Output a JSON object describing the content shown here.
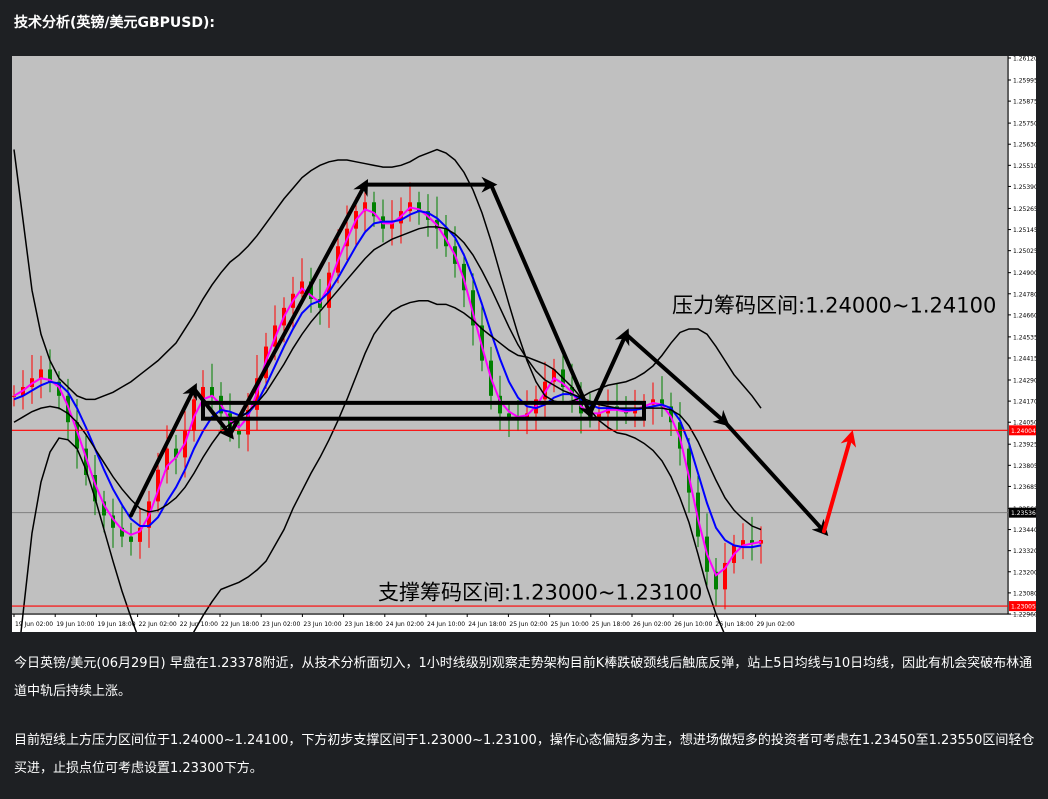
{
  "heading": "技术分析(英镑/美元GBPUSD):",
  "paragraphs": [
    "今日英镑/美元(06月29日) 早盘在1.23378附近，从技术分析面切入，1小时线级别观察走势架构目前K棒跌破颈线后触底反弹，站上5日均线与10日均线，因此有机会突破布林通道中轨后持续上涨。",
    "目前短线上方压力区间位于1.24000~1.24100，下方初步支撑区间于1.23000~1.23100，操作心态偏短多为主，想进场做短多的投资者可考虑在1.23450至1.23550区间轻仓买进，止损点位可考虑设置1.23300下方。"
  ],
  "chart_data": {
    "type": "line",
    "symbol": "GBPUSD",
    "ylim": [
      1.2296,
      1.2612
    ],
    "yticks": [
      "1.26120",
      "1.25995",
      "1.25875",
      "1.25750",
      "1.25630",
      "1.25510",
      "1.25390",
      "1.25265",
      "1.25145",
      "1.25025",
      "1.24900",
      "1.24780",
      "1.24660",
      "1.24535",
      "1.24415",
      "1.24290",
      "1.24170",
      "1.24050",
      "1.23925",
      "1.23805",
      "1.23685",
      "1.23560",
      "1.23440",
      "1.23320",
      "1.23200",
      "1.23080",
      "1.22960"
    ],
    "xticks": [
      "19 Jun 02:00",
      "19 Jun 10:00",
      "19 Jun 18:00",
      "22 Jun 02:00",
      "22 Jun 10:00",
      "22 Jun 18:00",
      "23 Jun 02:00",
      "23 Jun 10:00",
      "23 Jun 18:00",
      "24 Jun 02:00",
      "24 Jun 10:00",
      "24 Jun 18:00",
      "25 Jun 02:00",
      "25 Jun 10:00",
      "25 Jun 18:00",
      "26 Jun 02:00",
      "26 Jun 10:00",
      "26 Jun 18:00",
      "29 Jun 02:00"
    ],
    "current_price_label": "1.23536",
    "current_price": 1.23536,
    "resistance_label": "压力筹码区间:1.24000~1.24100",
    "resistance_level": 1.24004,
    "resistance_price_label": "1.24004",
    "support_label": "支撑筹码区间:1.23000~1.23100",
    "support_level": 1.23005,
    "support_price_label": "1.23005",
    "consolidation_box": [
      1.2407,
      1.2416
    ],
    "close": [
      1.242,
      1.2425,
      1.243,
      1.2435,
      1.2428,
      1.242,
      1.2405,
      1.239,
      1.2375,
      1.236,
      1.2352,
      1.2345,
      1.234,
      1.2337,
      1.2345,
      1.236,
      1.2378,
      1.239,
      1.2385,
      1.24,
      1.2418,
      1.2425,
      1.242,
      1.241,
      1.24,
      1.2398,
      1.2412,
      1.243,
      1.2448,
      1.246,
      1.247,
      1.2478,
      1.2485,
      1.2475,
      1.247,
      1.249,
      1.2505,
      1.2515,
      1.2525,
      1.253,
      1.2522,
      1.2515,
      1.2518,
      1.2525,
      1.253,
      1.2525,
      1.252,
      1.2515,
      1.2505,
      1.2495,
      1.248,
      1.246,
      1.244,
      1.242,
      1.241,
      1.2408,
      1.2406,
      1.241,
      1.2418,
      1.2428,
      1.2435,
      1.2425,
      1.242,
      1.241,
      1.2408,
      1.241,
      1.2414,
      1.2412,
      1.241,
      1.2412,
      1.2415,
      1.2418,
      1.2414,
      1.2405,
      1.239,
      1.2365,
      1.234,
      1.232,
      1.231,
      1.2325,
      1.2335,
      1.2338,
      1.2336,
      1.2338
    ],
    "series": [
      {
        "color": "#ff00ff",
        "values": [
          1.242,
          1.2423,
          1.2427,
          1.243,
          1.2429,
          1.2425,
          1.2414,
          1.24,
          1.2385,
          1.237,
          1.2358,
          1.235,
          1.2344,
          1.2341,
          1.2343,
          1.2352,
          1.2366,
          1.238,
          1.2385,
          1.2393,
          1.2408,
          1.2418,
          1.242,
          1.2415,
          1.2406,
          1.2402,
          1.2408,
          1.2422,
          1.244,
          1.2453,
          1.2465,
          1.2474,
          1.2481,
          1.2477,
          1.2473,
          1.2483,
          1.2497,
          1.2509,
          1.252,
          1.2526,
          1.2524,
          1.2518,
          1.2518,
          1.2522,
          1.2527,
          1.2526,
          1.2522,
          1.2517,
          1.2509,
          1.25,
          1.2486,
          1.2467,
          1.2448,
          1.243,
          1.2417,
          1.2411,
          1.2408,
          1.2409,
          1.2414,
          1.2422,
          1.243,
          1.2427,
          1.2422,
          1.2414,
          1.241,
          1.241,
          1.2412,
          1.2412,
          1.2411,
          1.2412,
          1.2414,
          1.2416,
          1.2415,
          1.2408,
          1.2396,
          1.2374,
          1.235,
          1.233,
          1.2318,
          1.2322,
          1.233,
          1.2335,
          1.2336,
          1.2337
        ]
      },
      {
        "color": "#0000ff",
        "values": [
          1.2418,
          1.242,
          1.2423,
          1.2426,
          1.2428,
          1.2427,
          1.2422,
          1.2413,
          1.2402,
          1.239,
          1.2378,
          1.2367,
          1.2358,
          1.235,
          1.2346,
          1.2346,
          1.2351,
          1.236,
          1.2368,
          1.2378,
          1.239,
          1.24,
          1.2408,
          1.2412,
          1.2411,
          1.2409,
          1.241,
          1.2416,
          1.2426,
          1.2437,
          1.2448,
          1.2458,
          1.2467,
          1.2472,
          1.2474,
          1.2479,
          1.2487,
          1.2496,
          1.2505,
          1.2513,
          1.2518,
          1.2519,
          1.2519,
          1.252,
          1.2523,
          1.2525,
          1.2524,
          1.2521,
          1.2516,
          1.251,
          1.25,
          1.2487,
          1.2472,
          1.2456,
          1.2441,
          1.2428,
          1.2419,
          1.2414,
          1.2413,
          1.2415,
          1.2419,
          1.2421,
          1.2421,
          1.2418,
          1.2415,
          1.2413,
          1.2413,
          1.2413,
          1.2412,
          1.2412,
          1.2413,
          1.2414,
          1.2415,
          1.2413,
          1.2406,
          1.2393,
          1.2376,
          1.2359,
          1.2345,
          1.2338,
          1.2335,
          1.2334,
          1.2334,
          1.2335
        ]
      },
      {
        "color": "#000000",
        "values": [
          1.2405,
          1.2408,
          1.2411,
          1.2413,
          1.2414,
          1.2413,
          1.241,
          1.2405,
          1.2398,
          1.239,
          1.2382,
          1.2374,
          1.2367,
          1.2361,
          1.2356,
          1.2354,
          1.2355,
          1.2358,
          1.2362,
          1.2368,
          1.2376,
          1.2385,
          1.2393,
          1.24,
          1.2404,
          1.2407,
          1.2411,
          1.2416,
          1.2422,
          1.243,
          1.2438,
          1.2447,
          1.2455,
          1.2462,
          1.2468,
          1.2474,
          1.248,
          1.2486,
          1.2492,
          1.2498,
          1.2503,
          1.2506,
          1.2509,
          1.2511,
          1.2513,
          1.2515,
          1.2516,
          1.2516,
          1.2515,
          1.2512,
          1.2507,
          1.25,
          1.2491,
          1.2481,
          1.247,
          1.2459,
          1.2449,
          1.2441,
          1.2434,
          1.2429,
          1.2426,
          1.2423,
          1.2421,
          1.2419,
          1.2417,
          1.2415,
          1.2414,
          1.2413,
          1.2413,
          1.2413,
          1.2413,
          1.2413,
          1.2413,
          1.2412,
          1.2409,
          1.2403,
          1.2394,
          1.2383,
          1.2372,
          1.2362,
          1.2355,
          1.235,
          1.2346,
          1.2344
        ]
      },
      {
        "color": "#000000",
        "values": [
          1.256,
          1.252,
          1.248,
          1.2455,
          1.244,
          1.243,
          1.2425,
          1.242,
          1.2418,
          1.2418,
          1.242,
          1.2422,
          1.2425,
          1.2428,
          1.2432,
          1.2436,
          1.244,
          1.2445,
          1.245,
          1.2458,
          1.2466,
          1.2475,
          1.2483,
          1.249,
          1.2496,
          1.25,
          1.2505,
          1.2511,
          1.2518,
          1.2525,
          1.2532,
          1.2538,
          1.2544,
          1.2548,
          1.2551,
          1.2553,
          1.2554,
          1.2554,
          1.2553,
          1.2552,
          1.2551,
          1.255,
          1.255,
          1.2551,
          1.2553,
          1.2556,
          1.2558,
          1.256,
          1.2558,
          1.2554,
          1.2547,
          1.2537,
          1.2524,
          1.2508,
          1.249,
          1.2472,
          1.2455,
          1.244,
          1.2428,
          1.242,
          1.2417,
          1.2416,
          1.2417,
          1.2419,
          1.2422,
          1.2424,
          1.2426,
          1.2427,
          1.2428,
          1.243,
          1.2433,
          1.2437,
          1.2443,
          1.245,
          1.2456,
          1.2458,
          1.2458,
          1.2455,
          1.2448,
          1.244,
          1.2432,
          1.2426,
          1.242,
          1.2413
        ]
      },
      {
        "color": "#000000",
        "values": [
          1.225,
          1.2296,
          1.2342,
          1.2371,
          1.2388,
          1.2396,
          1.2395,
          1.239,
          1.2378,
          1.2362,
          1.2344,
          1.2326,
          1.2309,
          1.2294,
          1.228,
          1.2272,
          1.227,
          1.2271,
          1.2274,
          1.2278,
          1.2286,
          1.2295,
          1.2303,
          1.231,
          1.2312,
          1.2314,
          1.2317,
          1.2321,
          1.2326,
          1.2335,
          1.2344,
          1.2356,
          1.2366,
          1.2376,
          1.2385,
          1.2395,
          1.2406,
          1.2418,
          1.2431,
          1.2444,
          1.2455,
          1.2462,
          1.2468,
          1.2471,
          1.2473,
          1.2474,
          1.2474,
          1.2472,
          1.2472,
          1.247,
          1.2467,
          1.2463,
          1.2458,
          1.2454,
          1.245,
          1.2446,
          1.2443,
          1.2442,
          1.244,
          1.2438,
          1.2435,
          1.243,
          1.2425,
          1.2419,
          1.2412,
          1.2406,
          1.2402,
          1.2399,
          1.2398,
          1.2396,
          1.2393,
          1.2389,
          1.2383,
          1.2374,
          1.2362,
          1.2348,
          1.233,
          1.2311,
          1.2296,
          1.2284,
          1.2278,
          1.2274,
          1.2272,
          1.2275
        ]
      }
    ],
    "annotations": [
      {
        "type": "arrow",
        "color": "#000000",
        "points": [
          [
            13,
            1.2352
          ],
          [
            20,
            1.2424
          ],
          [
            24,
            1.2398
          ]
        ]
      },
      {
        "type": "arrow",
        "color": "#000000",
        "points": [
          [
            24,
            1.2398
          ],
          [
            39,
            1.254
          ],
          [
            53,
            1.254
          ],
          [
            64,
            1.241
          ]
        ]
      },
      {
        "type": "arrow",
        "color": "#000000",
        "points": [
          [
            64,
            1.241
          ],
          [
            68,
            1.2455
          ],
          [
            79,
            1.2405
          ],
          [
            90,
            1.2343
          ]
        ]
      },
      {
        "type": "arrow",
        "color": "#ff0000",
        "points": [
          [
            90,
            1.2343
          ],
          [
            93,
            1.2397
          ]
        ]
      }
    ]
  }
}
